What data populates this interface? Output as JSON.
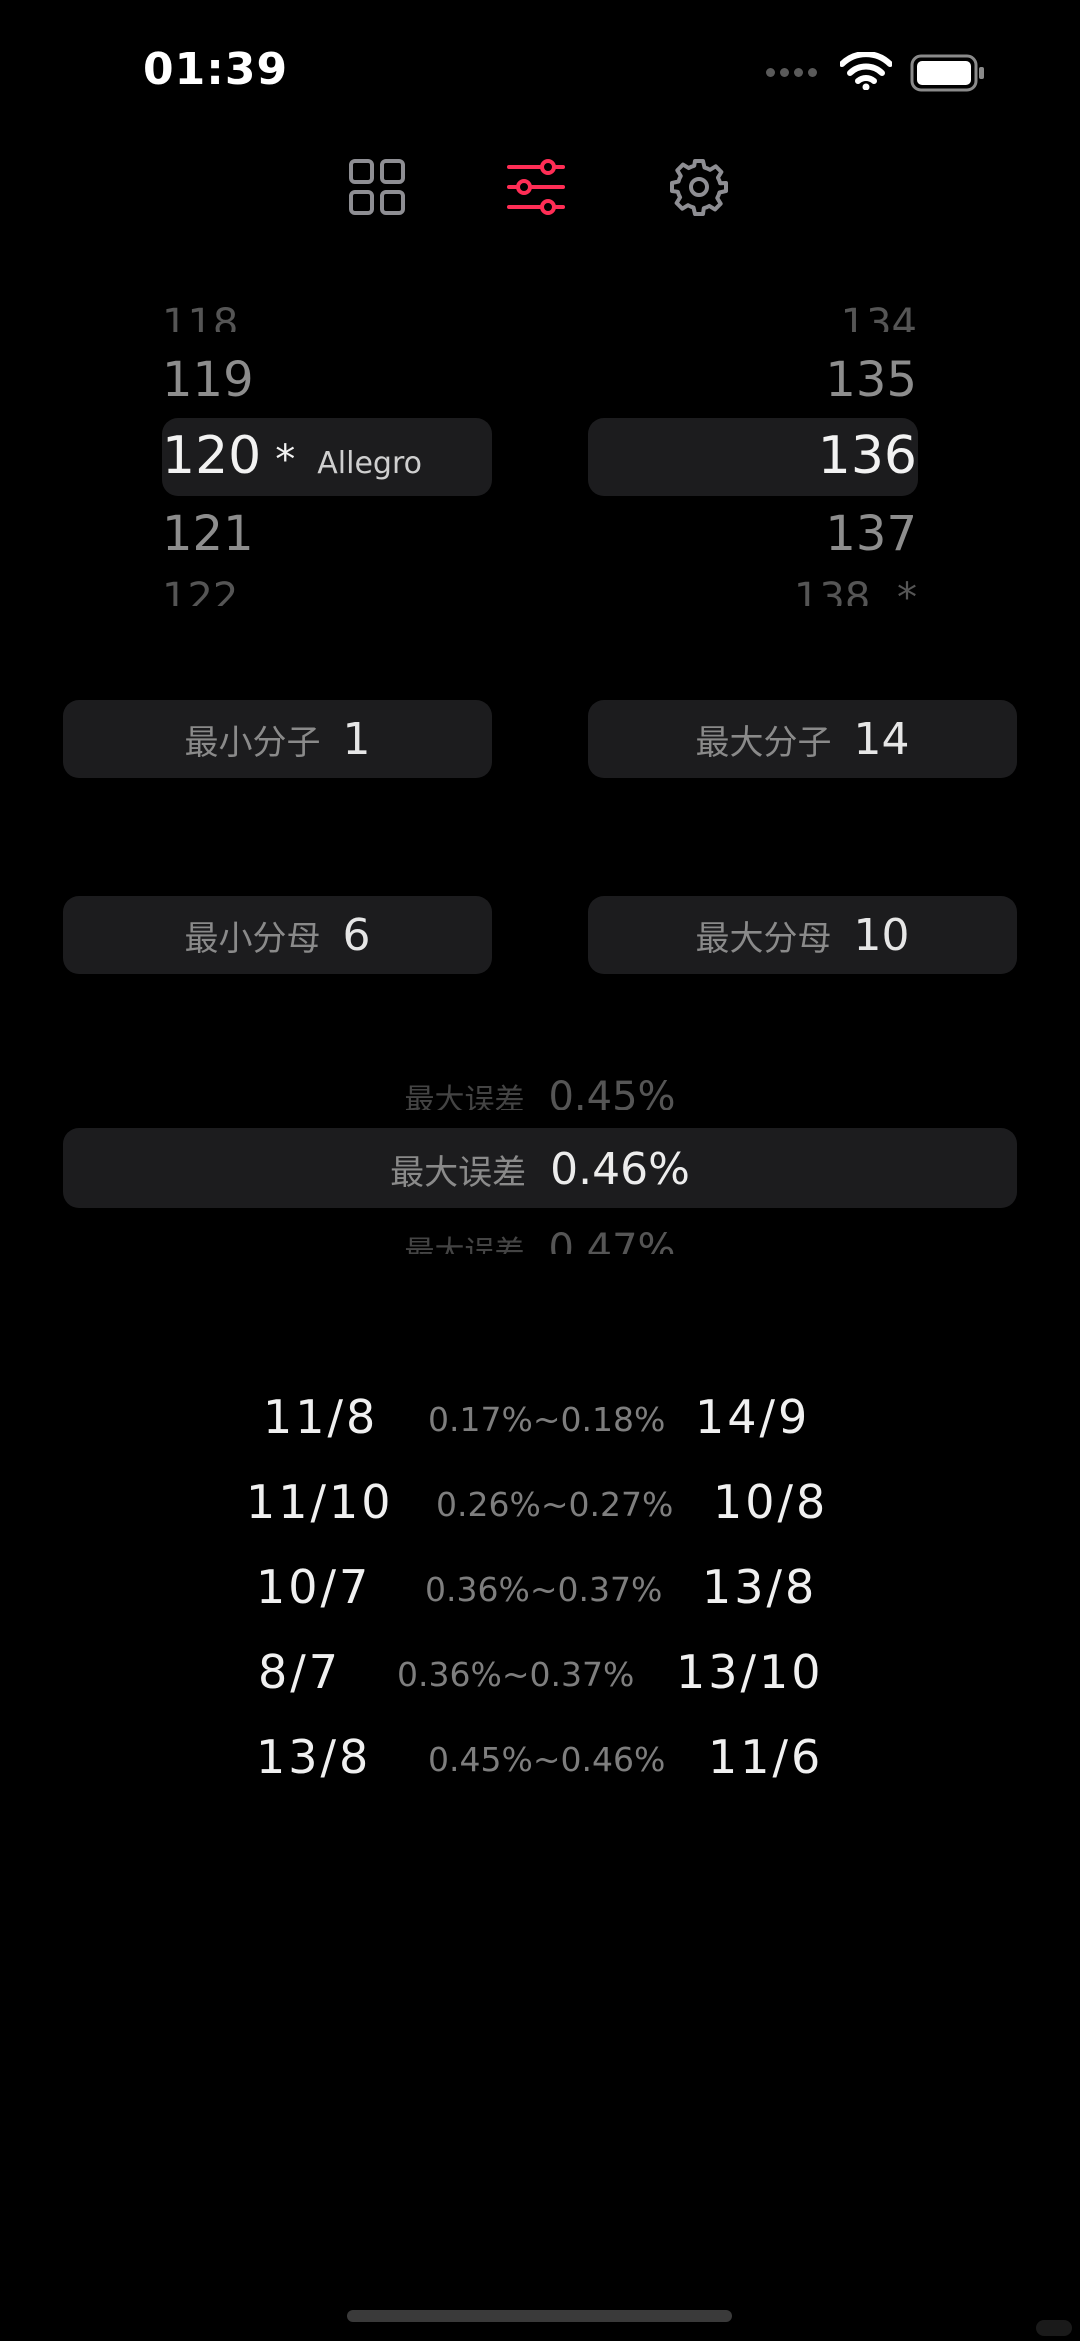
{
  "status_bar": {
    "time": "01:39"
  },
  "nav": {
    "active": "sliders"
  },
  "colors": {
    "accent": "#ff2d55",
    "icon_inactive": "#8e8e93",
    "pill_bg": "#1c1c1e"
  },
  "bpm_min": {
    "above2": "118",
    "above1": "119",
    "selected": "120",
    "marker": "*",
    "tempo_name": "Allegro",
    "below1": "121",
    "below2": "122"
  },
  "bpm_max": {
    "above2": "134",
    "above1": "135",
    "selected": "136",
    "below1": "137",
    "below2": "138",
    "below2_marker": "*"
  },
  "settings": {
    "min_numerator": {
      "label": "最小分子",
      "value": "1"
    },
    "max_numerator": {
      "label": "最大分子",
      "value": "14"
    },
    "min_denominator": {
      "label": "最小分母",
      "value": "6"
    },
    "max_denominator": {
      "label": "最大分母",
      "value": "10"
    }
  },
  "max_error": {
    "label": "最大误差",
    "above": "0.45%",
    "selected": "0.46%",
    "below": "0.47%"
  },
  "results": [
    {
      "a": "11/8",
      "range": "0.17%~0.18%",
      "b": "14/9"
    },
    {
      "a": "11/10",
      "range": "0.26%~0.27%",
      "b": "10/8"
    },
    {
      "a": "10/7",
      "range": "0.36%~0.37%",
      "b": "13/8"
    },
    {
      "a": "8/7",
      "range": "0.36%~0.37%",
      "b": "13/10"
    },
    {
      "a": "13/8",
      "range": "0.45%~0.46%",
      "b": "11/6"
    }
  ]
}
